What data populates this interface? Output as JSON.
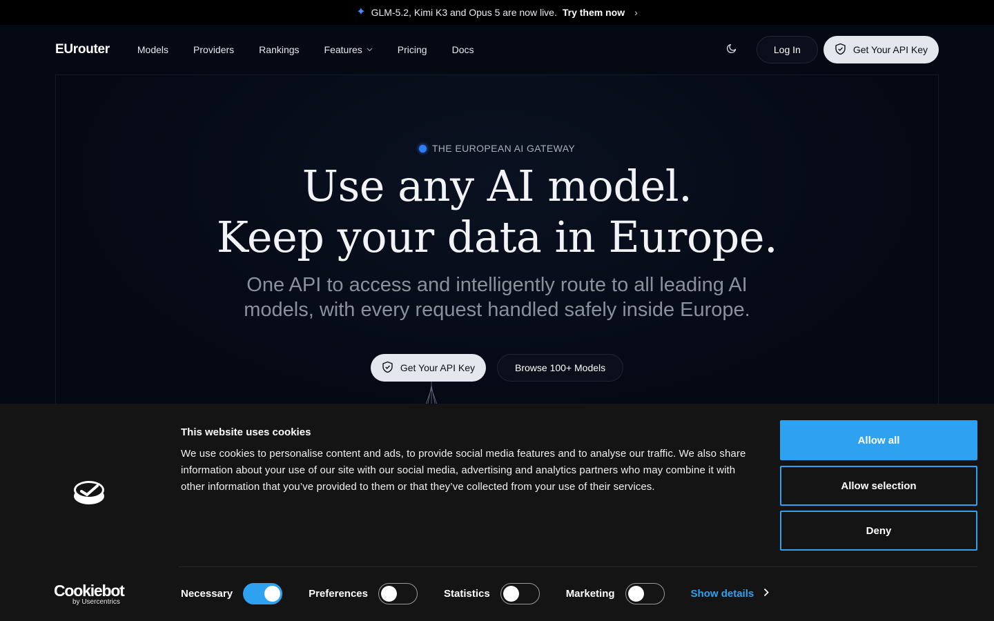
{
  "announcement": {
    "text": "GLM-5.2, Kimi K3 and Opus 5 are now live.",
    "cta": "Try them now",
    "icon": "sparkle-icon"
  },
  "nav": {
    "logo": "EUrouter",
    "links": [
      "Models",
      "Providers",
      "Rankings",
      "Features",
      "Pricing",
      "Docs"
    ],
    "login": "Log In",
    "api_key": "Get Your API Key"
  },
  "hero": {
    "eyebrow": "THE EUROPEAN AI GATEWAY",
    "headline_line1": "Use any AI model.",
    "headline_line2": "Keep your data in Europe.",
    "subhead_line1": "One API to access and intelligently route to all leading AI",
    "subhead_line2": "models, with every request handled safely inside Europe.",
    "cta_primary": "Get Your API Key",
    "cta_secondary": "Browse 100+ Models"
  },
  "cookie": {
    "title": "This website uses cookies",
    "body": "We use cookies to personalise content and ads, to provide social media features and to analyse our traffic. We also share information about your use of our site with our social media, advertising and analytics partners who may combine it with other information that you’ve provided to them or that they’ve collected from your use of their services.",
    "allow_all": "Allow all",
    "allow_selection": "Allow selection",
    "deny": "Deny",
    "brand_name": "Cookiebot",
    "brand_by": "by Usercentrics",
    "toggles": {
      "necessary": "Necessary",
      "preferences": "Preferences",
      "statistics": "Statistics",
      "marketing": "Marketing"
    },
    "show_details": "Show details",
    "accent": "#2ea2f0"
  }
}
